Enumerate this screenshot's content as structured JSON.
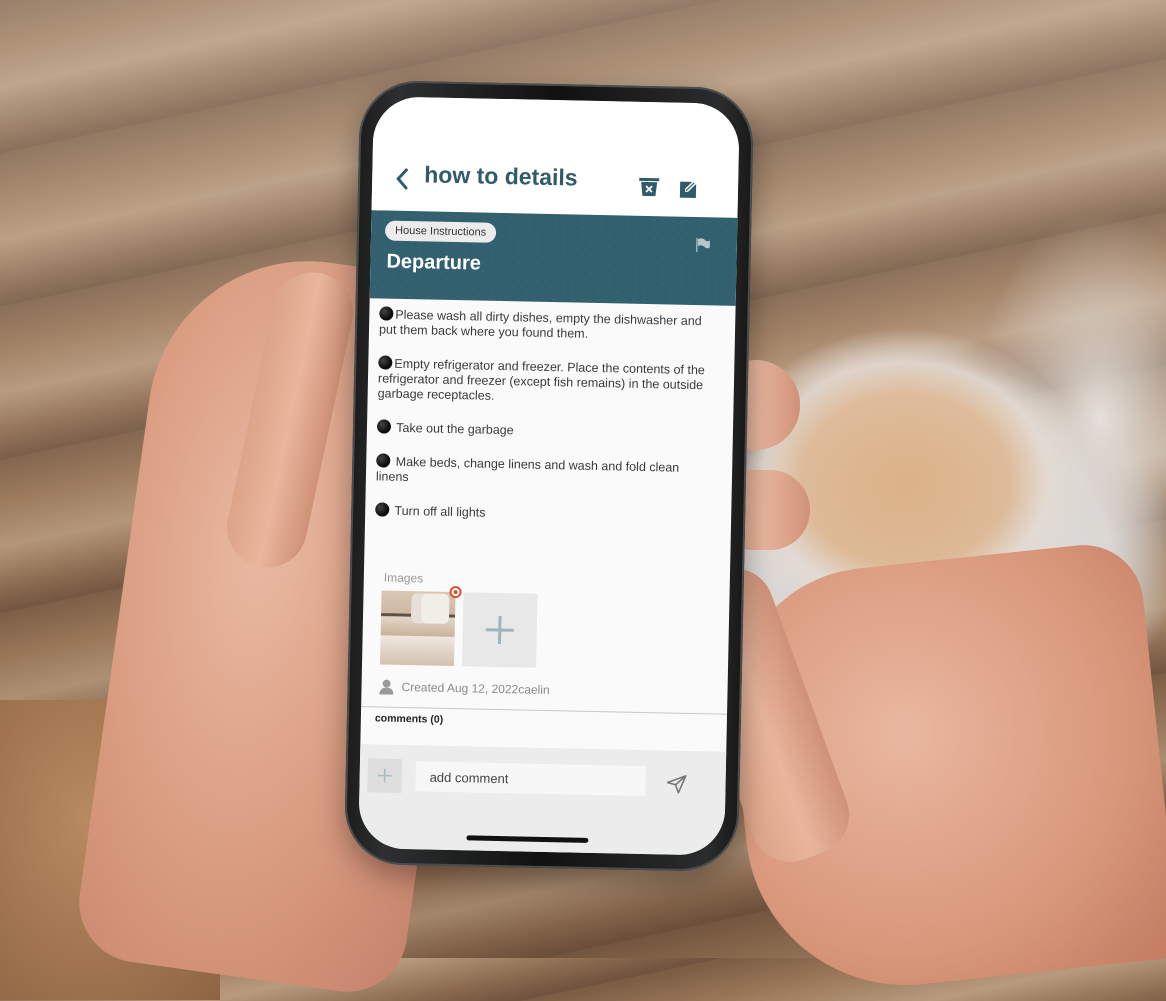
{
  "header": {
    "title": "how to details",
    "back_icon": "chevron-left-icon",
    "actions": [
      {
        "name": "delete",
        "icon": "trash-x-icon"
      },
      {
        "name": "edit",
        "icon": "edit-pencil-icon"
      }
    ]
  },
  "banner": {
    "category": "House Instructions",
    "title": "Departure",
    "flag_icon": "flag-icon"
  },
  "steps": [
    "Please wash all dirty dishes, empty the dishwasher and put them back where you found them.",
    "Empty refrigerator and freezer. Place the contents of the refrigerator and freezer (except fish remains) in the outside garbage receptacles.",
    " Take out the garbage",
    " Make beds, change linens and wash and fold clean linens",
    " Turn off all lights"
  ],
  "images": {
    "label": "Images",
    "count": 1,
    "add_icon": "plus-icon",
    "remove_icon": "remove-badge-icon"
  },
  "meta": {
    "created": "Created Aug 12, 2022caelin",
    "user_icon": "user-icon"
  },
  "comments": {
    "label": "comments (0)",
    "placeholder": "add comment",
    "add_icon": "plus-icon",
    "send_icon": "send-icon"
  },
  "colors": {
    "primary": "#2f5b6a",
    "banner": "#32606e",
    "remove_badge": "#d8512b"
  }
}
